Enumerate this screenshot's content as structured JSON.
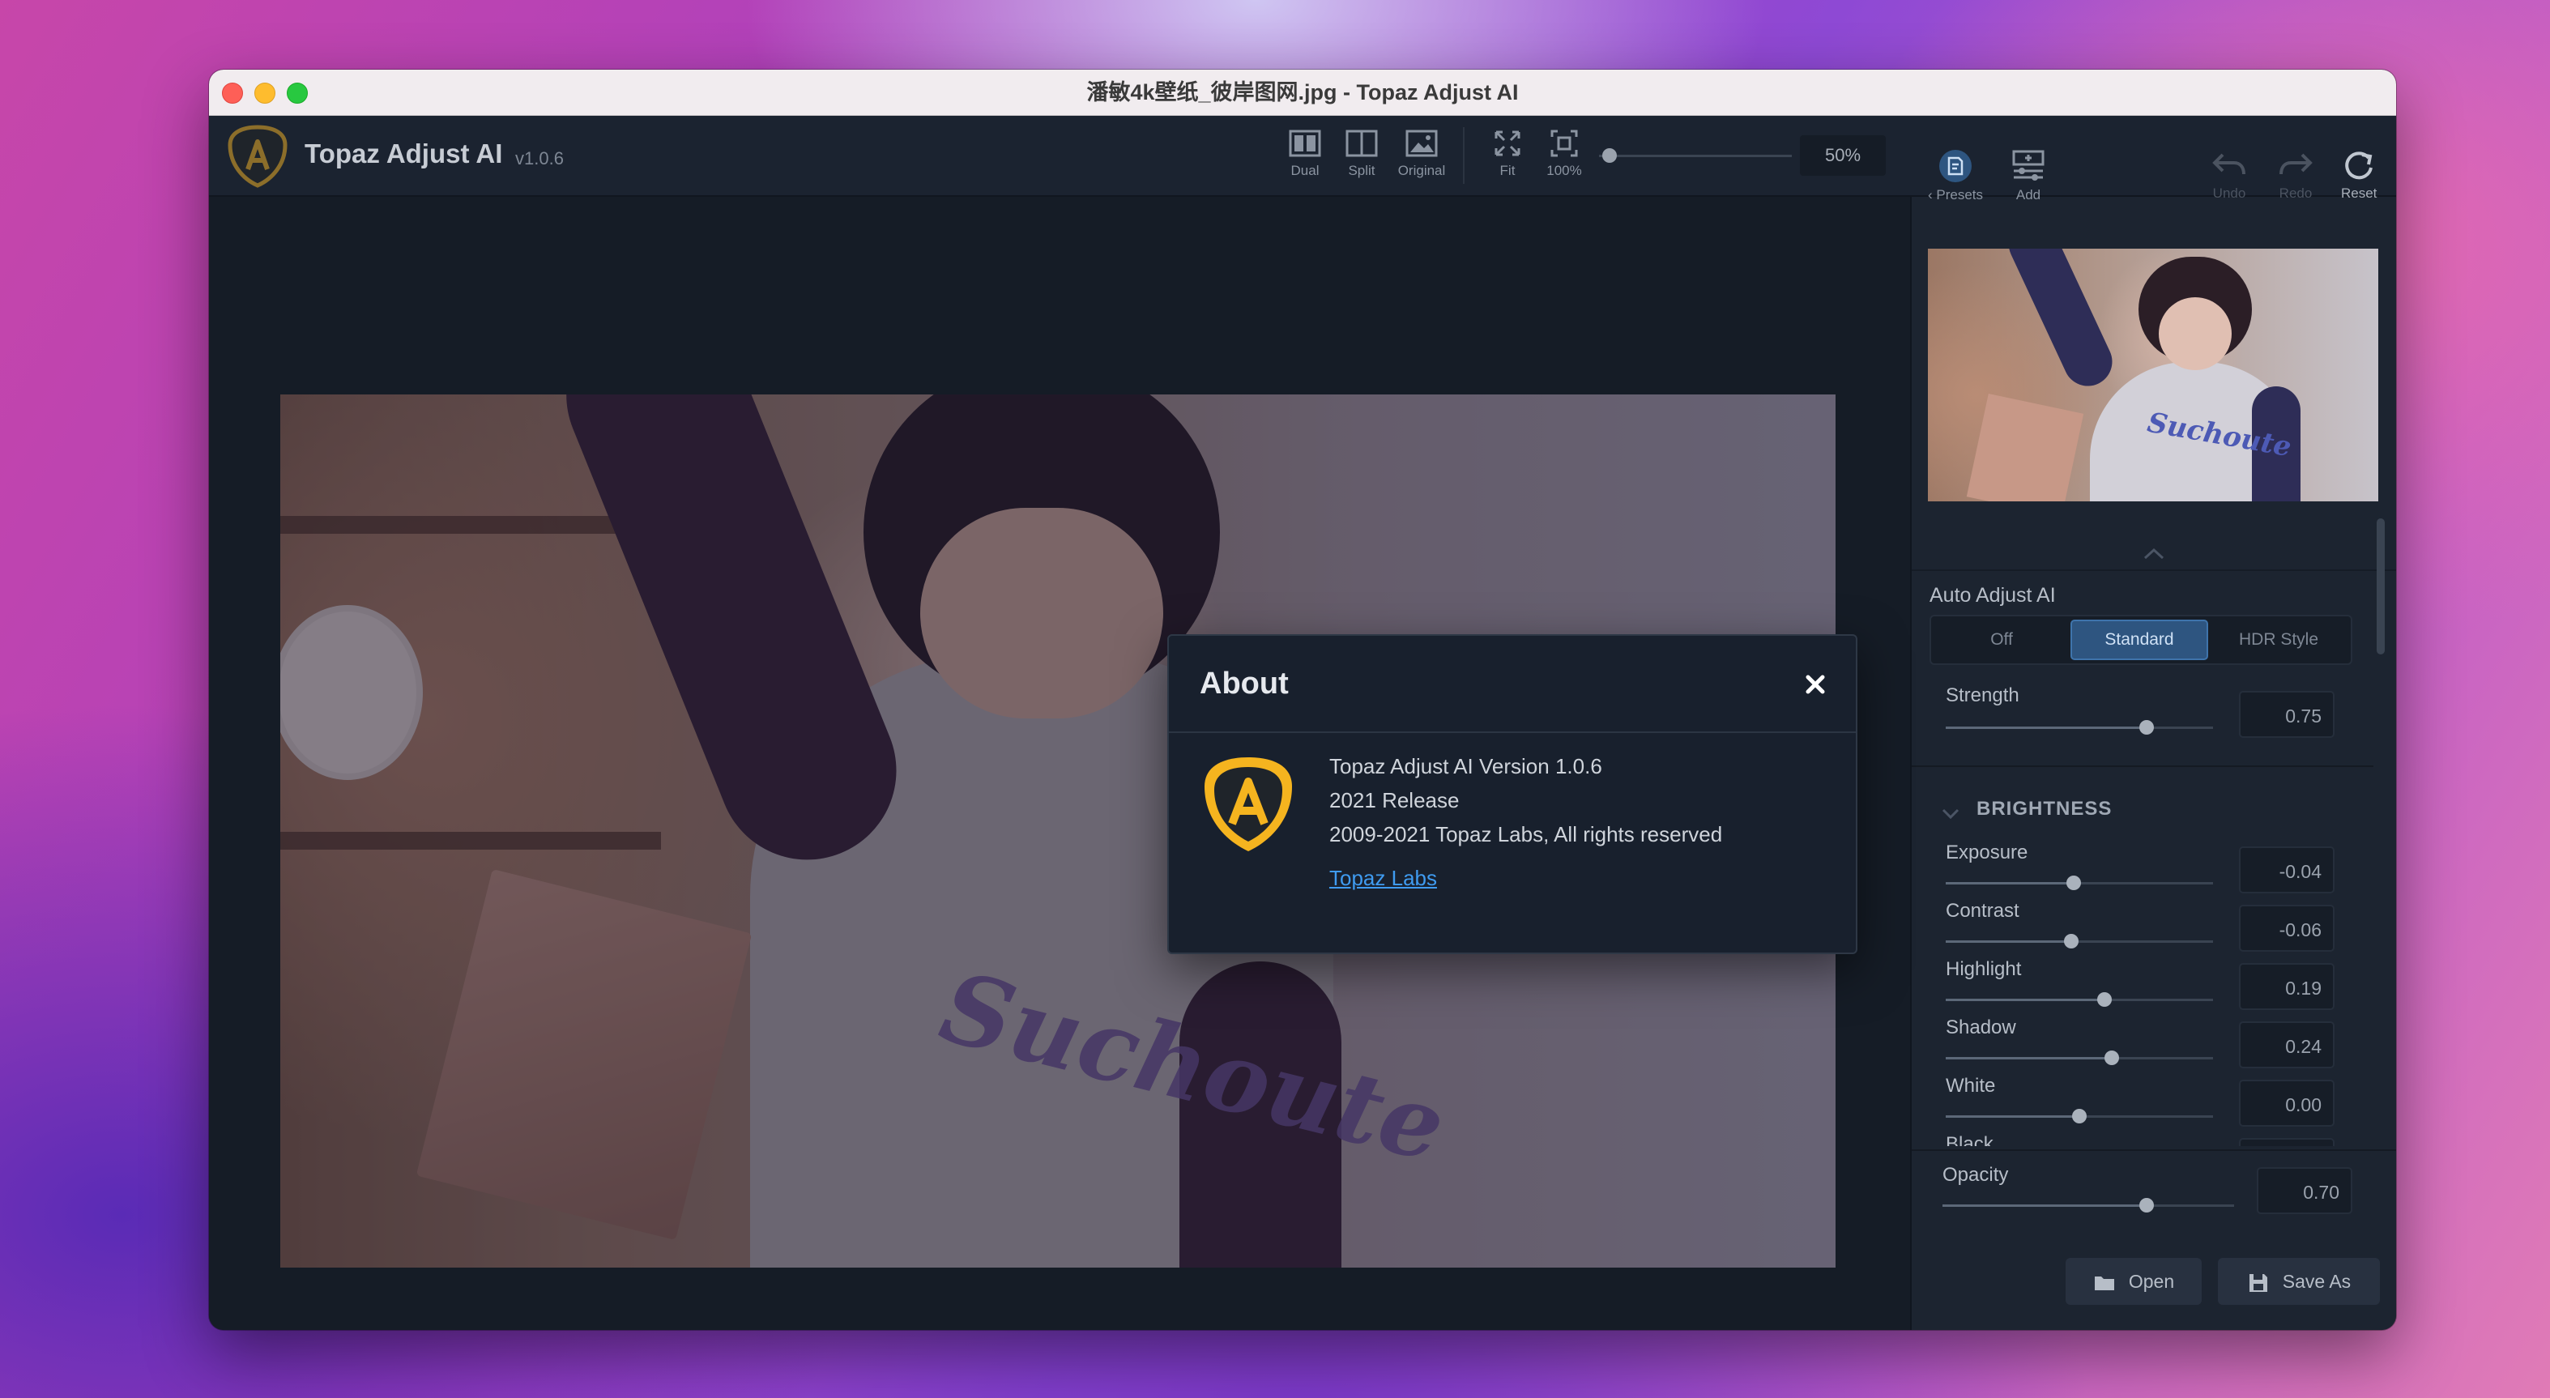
{
  "window": {
    "title": "潘敏4k壁纸_彼岸图网.jpg - Topaz Adjust AI"
  },
  "app": {
    "name": "Topaz Adjust AI",
    "version": "v1.0.6"
  },
  "toolbar": {
    "view_modes": [
      "Dual",
      "Split",
      "Original"
    ],
    "fit_label": "Fit",
    "actual_label": "100%",
    "zoom_value": "50%",
    "presets_label": "Presets",
    "add_label": "Add",
    "undo_label": "Undo",
    "redo_label": "Redo",
    "reset_label": "Reset"
  },
  "preview": {
    "shirt_text": "Suchoute",
    "thumb_text": "Suchoute"
  },
  "panel": {
    "auto_adjust": {
      "title": "Auto Adjust AI",
      "modes": [
        "Off",
        "Standard",
        "HDR Style"
      ],
      "selected": "Standard",
      "strength_label": "Strength",
      "strength_value": "0.75",
      "strength_fraction": 0.75
    },
    "brightness": {
      "title": "BRIGHTNESS",
      "exposure_label": "Exposure",
      "exposure_value": "-0.04",
      "exposure_fraction": 0.48,
      "contrast_label": "Contrast",
      "contrast_value": "-0.06",
      "contrast_fraction": 0.47,
      "highlight_label": "Highlight",
      "highlight_value": "0.19",
      "highlight_fraction": 0.595,
      "shadow_label": "Shadow",
      "shadow_value": "0.24",
      "shadow_fraction": 0.62,
      "white_label": "White",
      "white_value": "0.00",
      "white_fraction": 0.5,
      "black_label": "Black"
    },
    "opacity": {
      "label": "Opacity",
      "value": "0.70",
      "fraction": 0.7
    }
  },
  "footer": {
    "open_label": "Open",
    "save_as_label": "Save As"
  },
  "about": {
    "title": "About",
    "version_line": "Topaz Adjust AI Version 1.0.6",
    "release_line": "2021 Release",
    "copyright_line": "2009-2021 Topaz Labs, All rights reserved",
    "link_text": "Topaz Labs"
  },
  "colors": {
    "accent": "#3f9bf0",
    "logo_gold": "#f5b41f",
    "panel_bg": "#1c2430"
  },
  "icons": [
    "dual-view-icon",
    "split-view-icon",
    "original-view-icon",
    "fit-icon",
    "actual-size-icon",
    "presets-icon",
    "add-preset-icon",
    "undo-icon",
    "redo-icon",
    "reset-icon",
    "folder-icon",
    "save-icon",
    "close-icon",
    "chevron-up-icon",
    "chevron-down-icon"
  ]
}
